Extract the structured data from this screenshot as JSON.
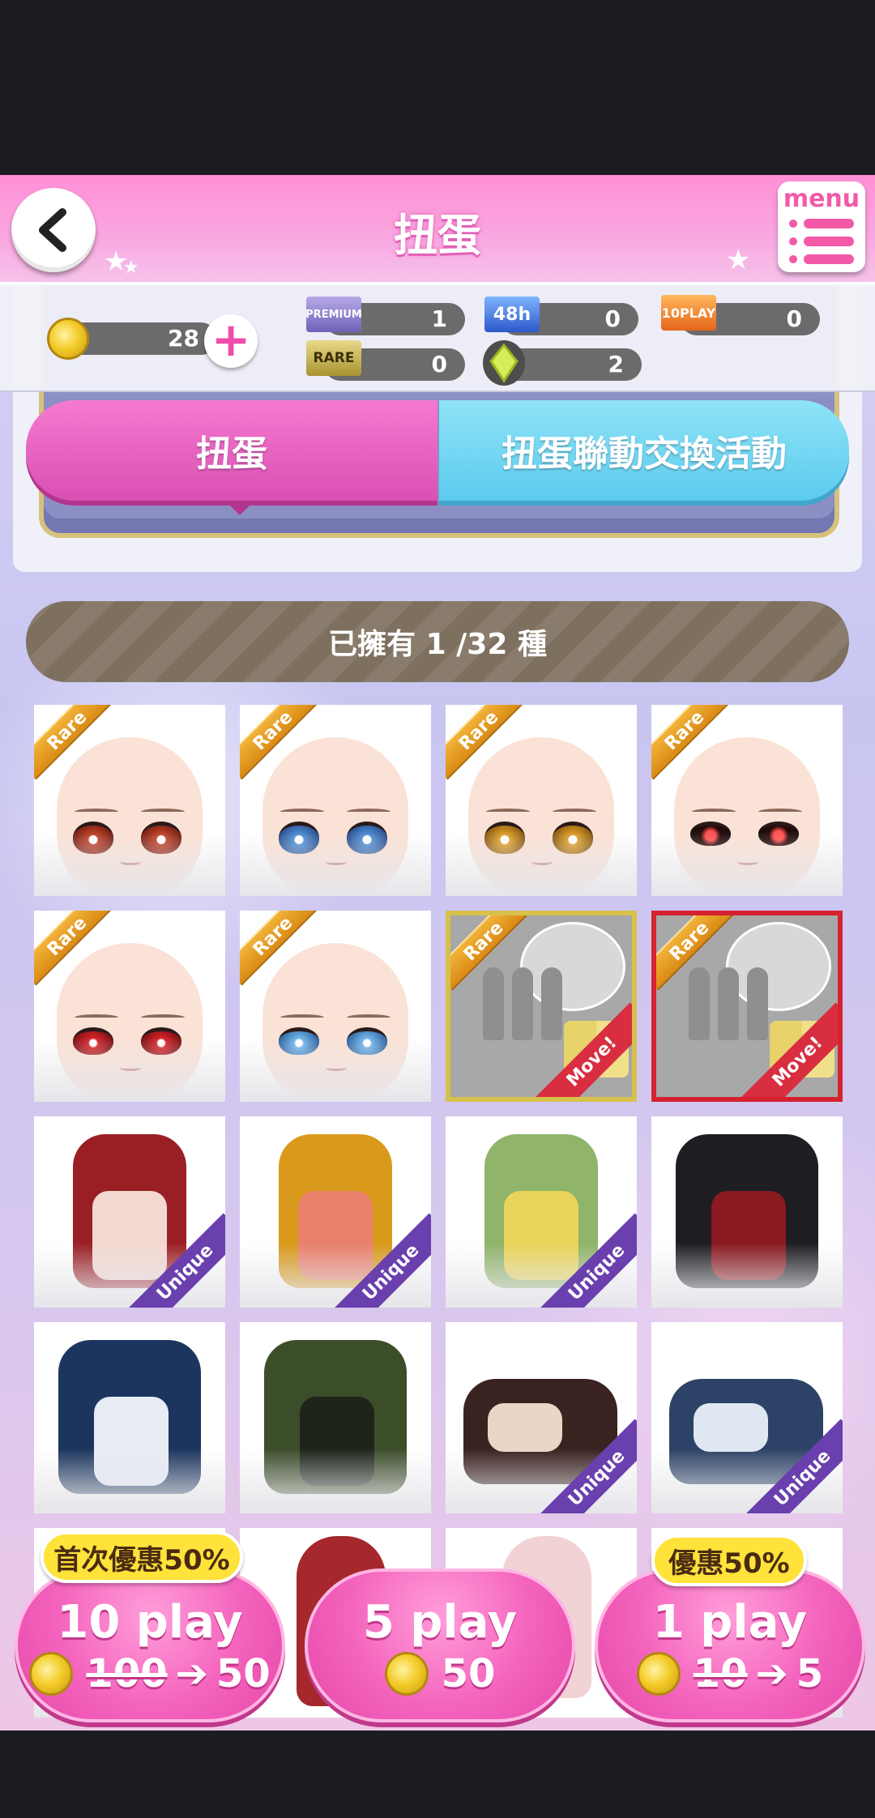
{
  "header": {
    "title": "扭蛋",
    "menu_label": "menu"
  },
  "currency": {
    "coins": "28",
    "premium_label": "PREMIUM",
    "premium_count": "1",
    "ticket48_label": "48h",
    "ticket48_count": "0",
    "play10_label": "10PLAY",
    "play10_count": "0",
    "rare_label": "RARE",
    "rare_count": "0",
    "gem_count": "2",
    "hidden_scale": [
      "0",
      "60",
      "80",
      "100"
    ]
  },
  "tabs": {
    "gacha": "扭蛋",
    "event": "扭蛋聯動交換活動"
  },
  "owned": "已擁有 1 /32 種",
  "tags": {
    "rare": "Rare",
    "unique": "Unique",
    "move": "Move!"
  },
  "buttons": [
    {
      "play": "10 play",
      "price_old": "100",
      "price_new": "50",
      "promo": "首次優惠50%"
    },
    {
      "play": "5 play",
      "price": "50"
    },
    {
      "play": "1 play",
      "price_old": "10",
      "price_new": "5",
      "promo": "優惠50%"
    }
  ],
  "colors": {
    "accent_pink": "#f463bd",
    "header_pink": "#ff8fd6",
    "tab_blue": "#5ccbee",
    "unique_purple": "#6a3fae",
    "move_red": "#d92d40"
  }
}
